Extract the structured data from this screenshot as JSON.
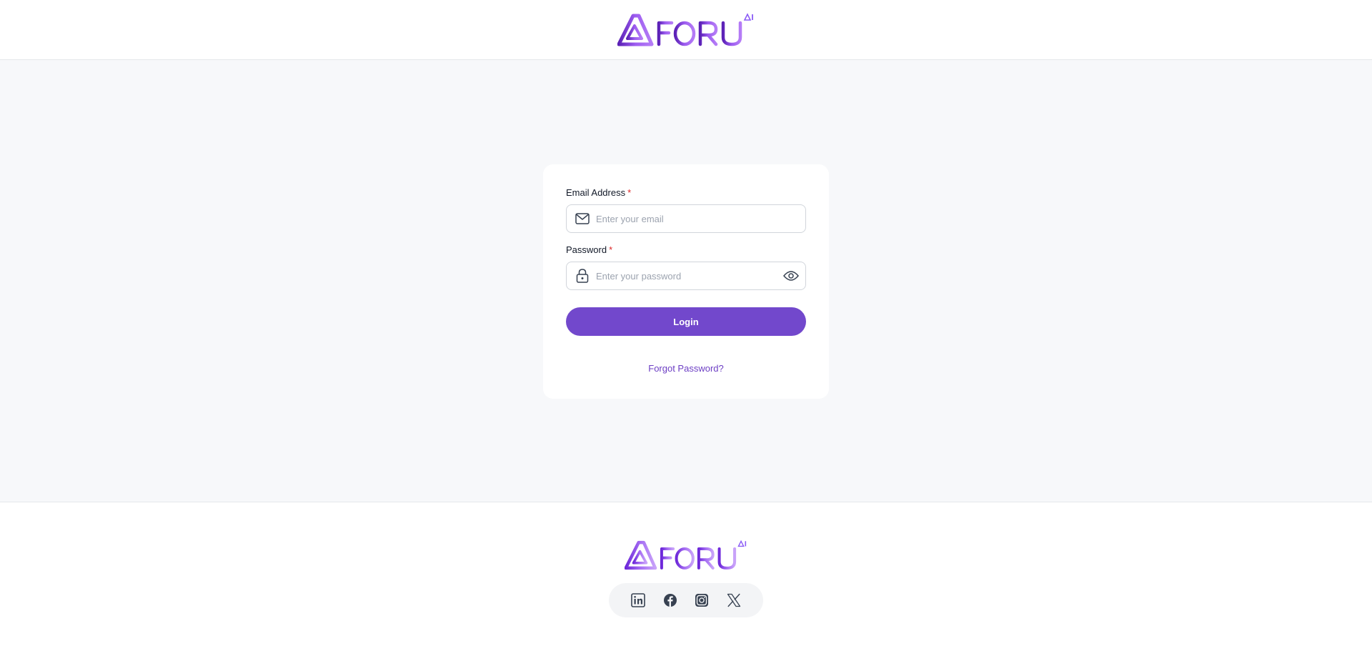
{
  "brand": {
    "logo_text": "FORU",
    "logo_superscript": "AI",
    "colors": {
      "accent": "#7248cc",
      "logo_gradient_start": "#5b21b6",
      "logo_gradient_end": "#c084fc"
    }
  },
  "login_form": {
    "email": {
      "label": "Email Address",
      "required_mark": "*",
      "placeholder": "Enter your email",
      "value": "",
      "icon": "mail-icon"
    },
    "password": {
      "label": "Password",
      "required_mark": "*",
      "placeholder": "Enter your password",
      "value": "",
      "icon": "lock-icon",
      "toggle_icon": "eye-icon"
    },
    "login_label": "Login",
    "forgot_label": "Forgot Password?"
  },
  "footer": {
    "social": [
      "linkedin-icon",
      "facebook-icon",
      "instagram-icon",
      "x-icon"
    ]
  }
}
